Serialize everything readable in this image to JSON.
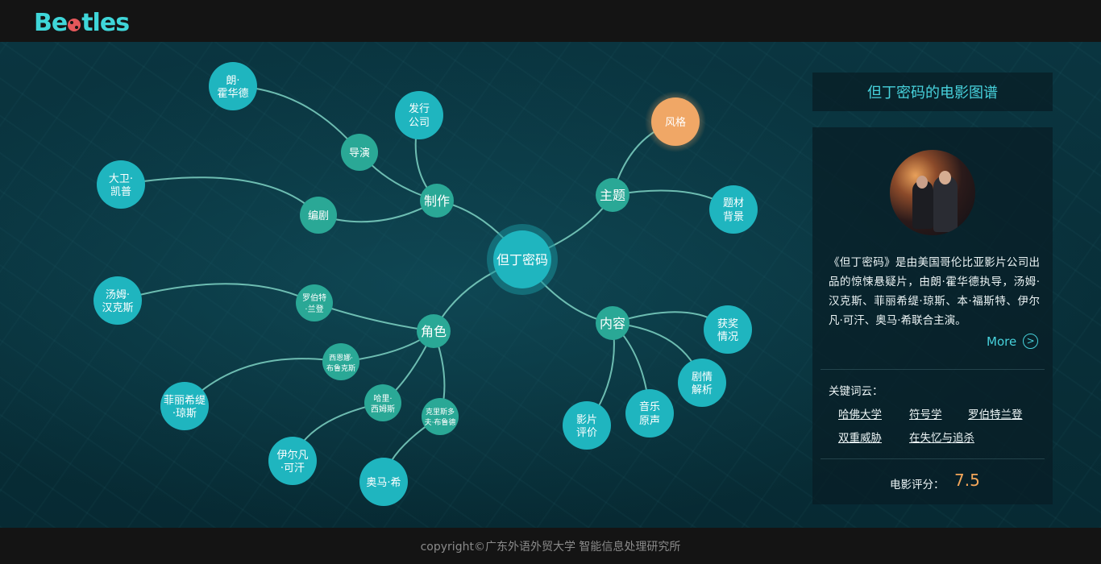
{
  "header": {
    "logo_text_a": "Be",
    "logo_text_b": "tles"
  },
  "graph": {
    "center": {
      "label": "但丁密码"
    },
    "nodes": {
      "zhizuo": "制作",
      "zhuti": "主题",
      "jiaose": "角色",
      "neirong": "内容",
      "daoyan": "导演",
      "bianju": "编剧",
      "faxing": [
        "发行",
        "公司"
      ],
      "lang": [
        "朗·",
        "霍华德"
      ],
      "dawei": [
        "大卫·",
        "凯普"
      ],
      "fengge": "风格",
      "ticai": [
        "题材",
        "背景"
      ],
      "huojiang": [
        "获奖",
        "情况"
      ],
      "juqing": [
        "剧情",
        "解析"
      ],
      "yinyue": [
        "音乐",
        "原声"
      ],
      "yingpian": [
        "影片",
        "评价"
      ],
      "tangmu": [
        "汤姆·",
        "汉克斯"
      ],
      "luobote": [
        "罗伯特",
        "·兰登"
      ],
      "xiensina": [
        "西恩娜·",
        "布鲁克斯"
      ],
      "feili": [
        "菲丽希缇",
        "·琼斯"
      ],
      "hali": [
        "哈里·",
        "西姆斯"
      ],
      "keli": [
        "克里斯多",
        "夫·布鲁德"
      ],
      "yierfan": [
        "伊尔凡",
        "·可汗"
      ],
      "aoma": "奥马·希"
    }
  },
  "panel": {
    "title": "但丁密码的电影图谱",
    "description": "《但丁密码》是由美国哥伦比亚影片公司出品的惊悚悬疑片，由朗·霍华德执导，汤姆·汉克斯、菲丽希缇·琼斯、本·福斯特、伊尔凡·可汗、奥马·希联合主演。",
    "more_label": "More",
    "more_icon": "chevron-right-circle-icon",
    "keywords_label": "关键词云：",
    "keywords": [
      "哈佛大学",
      "符号学",
      "罗伯特兰登",
      "双重威胁",
      "在失忆与追杀"
    ],
    "rating_label": "电影评分：",
    "rating_value": "7.5"
  },
  "footer": {
    "copyright": "copyright©广东外语外贸大学 智能信息处理研究所"
  },
  "colors": {
    "node": "#1fb5bf",
    "hub": "#2aa896",
    "highlight": "#f0a766",
    "link": "#7fd3c4",
    "accent": "#47d2dc",
    "score": "#f2a65a"
  }
}
